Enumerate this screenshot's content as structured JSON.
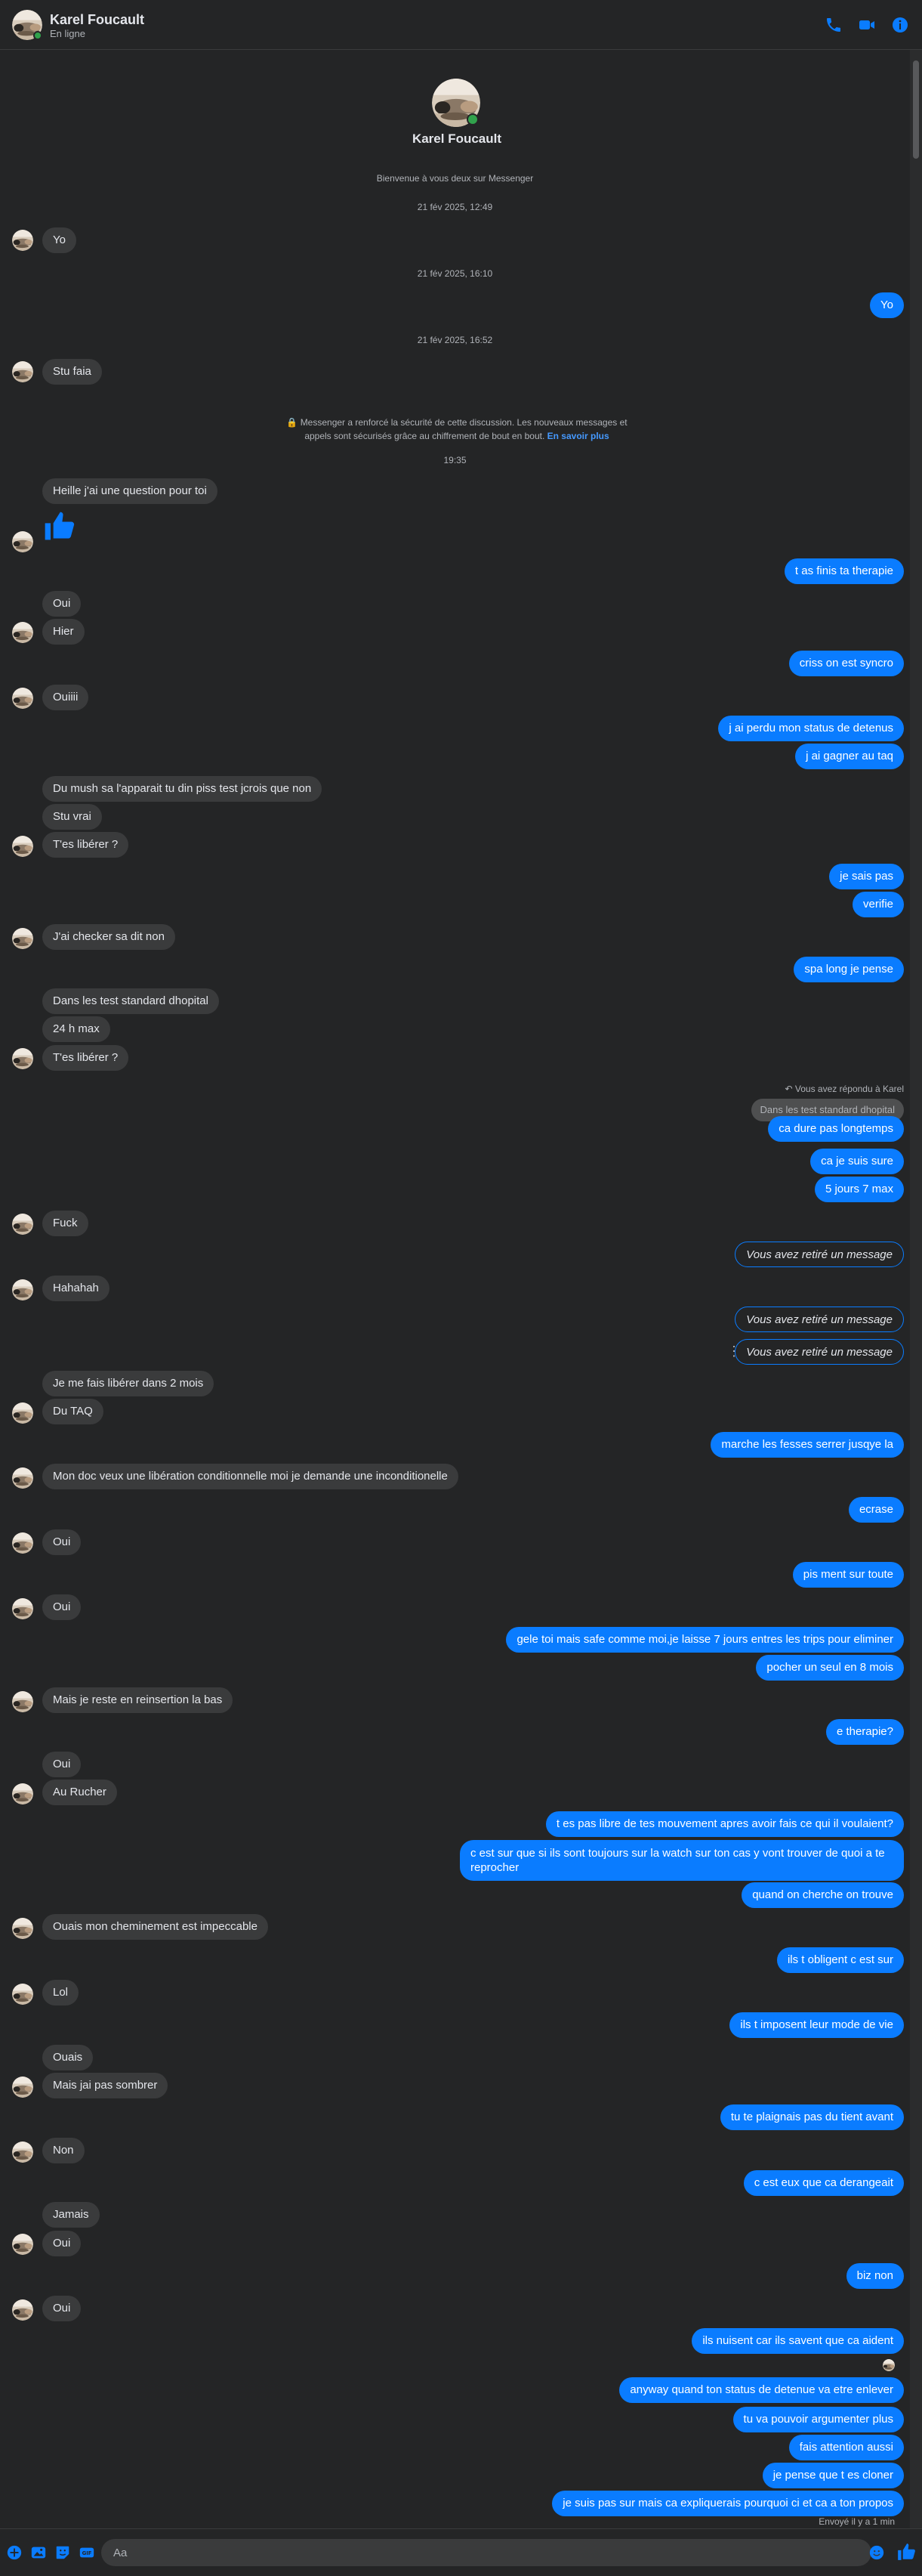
{
  "header": {
    "name": "Karel Foucault",
    "status": "En ligne",
    "icons": [
      "phone-icon",
      "video-icon",
      "info-icon"
    ]
  },
  "intro": {
    "name": "Karel Foucault",
    "welcome": "Bienvenue à vous deux sur Messenger"
  },
  "timestamps": [
    "21 fév 2025, 12:49",
    "21 fév 2025, 16:10",
    "21 fév 2025, 16:52",
    "19:35"
  ],
  "security": {
    "text": "Messenger a renforcé la sécurité de cette discussion. Les nouveaux messages et appels sont sécurisés grâce au chiffrement de bout en bout.",
    "link": "En savoir plus"
  },
  "reply": {
    "label": "Vous avez répondu à Karel",
    "quote": "Dans les test standard dhopital"
  },
  "removed_label": "Vous avez retiré un message",
  "messages": {
    "in": [
      "Yo",
      "Stu faia",
      "Heille j'ai une question pour toi",
      "Oui",
      "Hier",
      "Ouiiii",
      "Du mush sa l'apparait tu din piss test jcrois que non",
      "Stu vrai",
      "T'es libérer ?",
      "J'ai checker sa dit non",
      "Dans les test standard dhopital",
      "24 h max",
      "T'es libérer ?",
      "Fuck",
      "Hahahah",
      "Je me fais libérer dans 2 mois",
      "Du TAQ",
      "Mon doc veux une libération conditionnelle moi je demande une inconditionelle",
      "Oui",
      "Oui",
      "Mais je reste en reinsertion la bas",
      "Oui",
      "Au Rucher",
      "Ouais mon cheminement est impeccable",
      "Lol",
      "Ouais",
      "Mais jai pas sombrer",
      "Non",
      "Jamais",
      "Oui",
      "Oui"
    ],
    "out": [
      "Yo",
      "t as finis ta therapie",
      "criss on est syncro",
      "j ai perdu mon status de detenus",
      "j ai gagner au taq",
      "je sais pas",
      "verifie",
      "spa long je pense",
      "ca dure pas longtemps",
      "ca je suis sure",
      "5 jours 7 max",
      "marche les fesses serrer jusqye la",
      "ecrase",
      "pis ment sur toute",
      "gele toi mais safe comme moi,je laisse 7 jours entres les trips pour eliminer",
      "pocher un seul en 8 mois",
      "e therapie?",
      "t es pas libre de tes mouvement apres avoir fais ce qui il voulaient?",
      "c est sur que si ils sont toujours sur la watch sur ton cas y vont trouver de quoi a te reprocher",
      "quand on cherche on trouve",
      "ils t obligent c est sur",
      "ils t imposent leur mode de vie",
      "tu te plaignais pas du tient avant",
      "c est eux que ca derangeait",
      "biz non",
      "ils nuisent car ils savent que ca aident",
      "anyway quand ton status de detenue va etre enlever",
      "tu va pouvoir argumenter plus",
      "fais attention aussi",
      "je pense que t es cloner",
      "je suis pas sur mais ca expliquerais pourquoi ci et ca a ton propos"
    ]
  },
  "sent_status": "Envoyé il y a 1 min",
  "composer": {
    "placeholder": "Aa",
    "icons": [
      "plus-circle-icon",
      "photo-icon",
      "sticker-icon",
      "gif-icon",
      "emoji-icon",
      "like-icon"
    ]
  },
  "colors": {
    "background": "#242526",
    "incoming_bubble": "#3a3b3c",
    "outgoing_bubble": "#0a7cff",
    "online": "#31a24c"
  }
}
